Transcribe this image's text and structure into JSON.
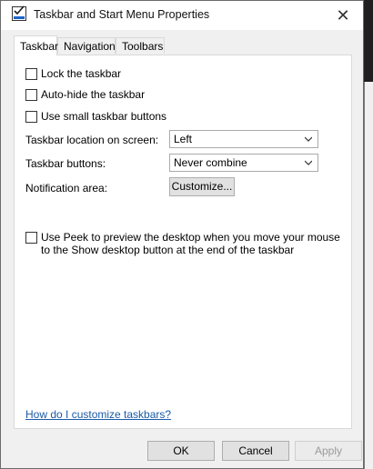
{
  "window": {
    "title": "Taskbar and Start Menu Properties"
  },
  "tabs": [
    {
      "label": "Taskbar"
    },
    {
      "label": "Navigation"
    },
    {
      "label": "Toolbars"
    }
  ],
  "options": {
    "lock_taskbar": {
      "label": "Lock the taskbar",
      "checked": false
    },
    "auto_hide": {
      "label": "Auto-hide the taskbar",
      "checked": false
    },
    "small_buttons": {
      "label": "Use small taskbar buttons",
      "checked": false
    }
  },
  "settings": {
    "location_label": "Taskbar location on screen:",
    "location_value": "Left",
    "buttons_label": "Taskbar buttons:",
    "buttons_value": "Never combine",
    "notification_label": "Notification area:",
    "customize_label": "Customize..."
  },
  "peek": {
    "label": "Use Peek to preview the desktop when you move your mouse to the Show desktop button at the end of the taskbar",
    "checked": false
  },
  "help_link": "How do I customize taskbars?",
  "footer": {
    "ok": "OK",
    "cancel": "Cancel",
    "apply": "Apply"
  }
}
